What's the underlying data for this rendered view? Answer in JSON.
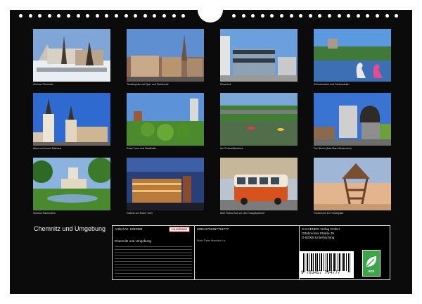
{
  "cover": {
    "title": "Chemnitz und Umgebung"
  },
  "photos": [
    {
      "caption": "Schloss Chemnitz"
    },
    {
      "caption": "Theaterplatz mit Oper und Petrikirche"
    },
    {
      "caption": "Rosenhof"
    },
    {
      "caption": "Schlossteiche und Schlossteich"
    },
    {
      "caption": "Altes und neues Rathaus"
    },
    {
      "caption": "Roter Turm und Stadthalle"
    },
    {
      "caption": "Am Pelzmühlenteich"
    },
    {
      "caption": "Der Nischl (Karl-Marx-Monument)"
    },
    {
      "caption": "Schloss Rabenstein"
    },
    {
      "caption": "Galerie am Roten Turm"
    },
    {
      "caption": "Alter Robur-Bus vor dem Hauptbahnhof"
    },
    {
      "caption": "Förderturm im Freizeitpark"
    }
  ],
  "panel": {
    "article_label": "Artikel-Nr. 1993399",
    "logo_text": "CALVENDO",
    "product_title": "Chemnitz und Umgebung",
    "isbn": "ISBN 9783457794777",
    "author": "Klaus-Peter Huschka u.a.",
    "publisher_name": "CALVENDO Verlag GmbH",
    "publisher_street": "Ottobrunner Straße 39",
    "publisher_city": "D-82008 Unterhaching",
    "barcode_number": "9 783457 794777",
    "eco_label": "eco"
  },
  "colors": {
    "background": "#0b0b0b",
    "eco_green": "#3aa648",
    "logo_red": "#b40000"
  }
}
